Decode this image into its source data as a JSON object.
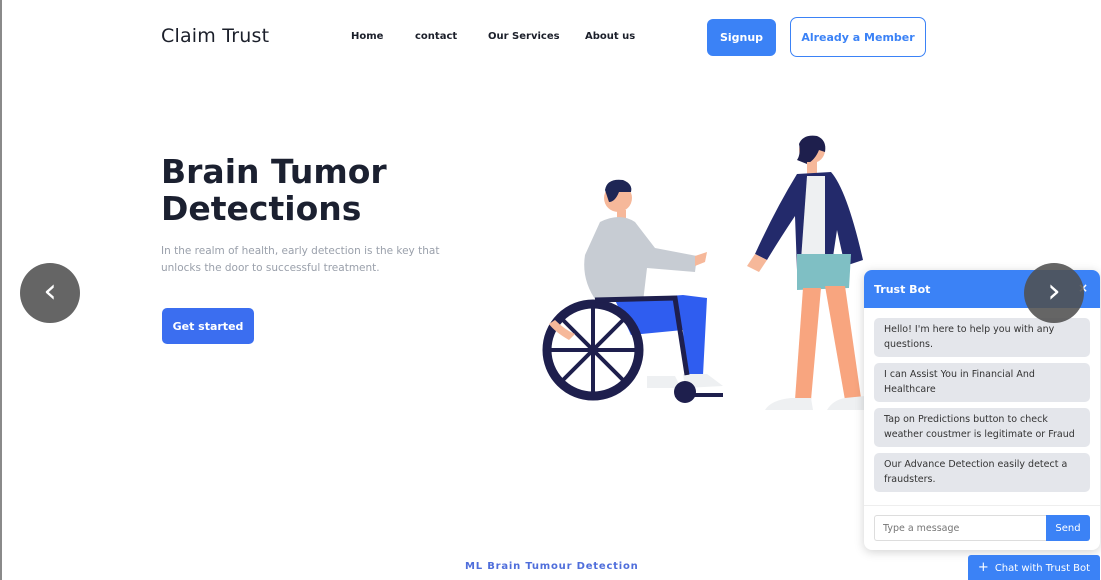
{
  "brand": {
    "logo": "Claim Trust"
  },
  "nav": {
    "items": [
      "Home",
      "contact",
      "Our Services",
      "About us"
    ],
    "signup": "Signup",
    "member": "Already a Member"
  },
  "hero": {
    "title": "Brain Tumor Detections",
    "description": "In the realm of health, early detection is the key that unlocks the door to successful treatment.",
    "cta": "Get started"
  },
  "carousel": {
    "prev": "‹",
    "next": "›"
  },
  "chat": {
    "title": "Trust Bot",
    "close": "×",
    "messages": [
      "Hello! I'm here to help you with any questions.",
      "I can Assist You in Financial And Healthcare",
      "Tap on Predictions button to check weather coustmer is legitimate or Fraud",
      "Our Advance Detection easily detect a fraudsters."
    ],
    "input_placeholder": "Type a message",
    "send": "Send",
    "launcher": "Chat with Trust Bot"
  },
  "footer": {
    "text": "ML Brain Tumour Detection"
  },
  "colors": {
    "accent": "#3b82f6",
    "cta": "#3b6ef0",
    "dark": "#1b2030"
  }
}
